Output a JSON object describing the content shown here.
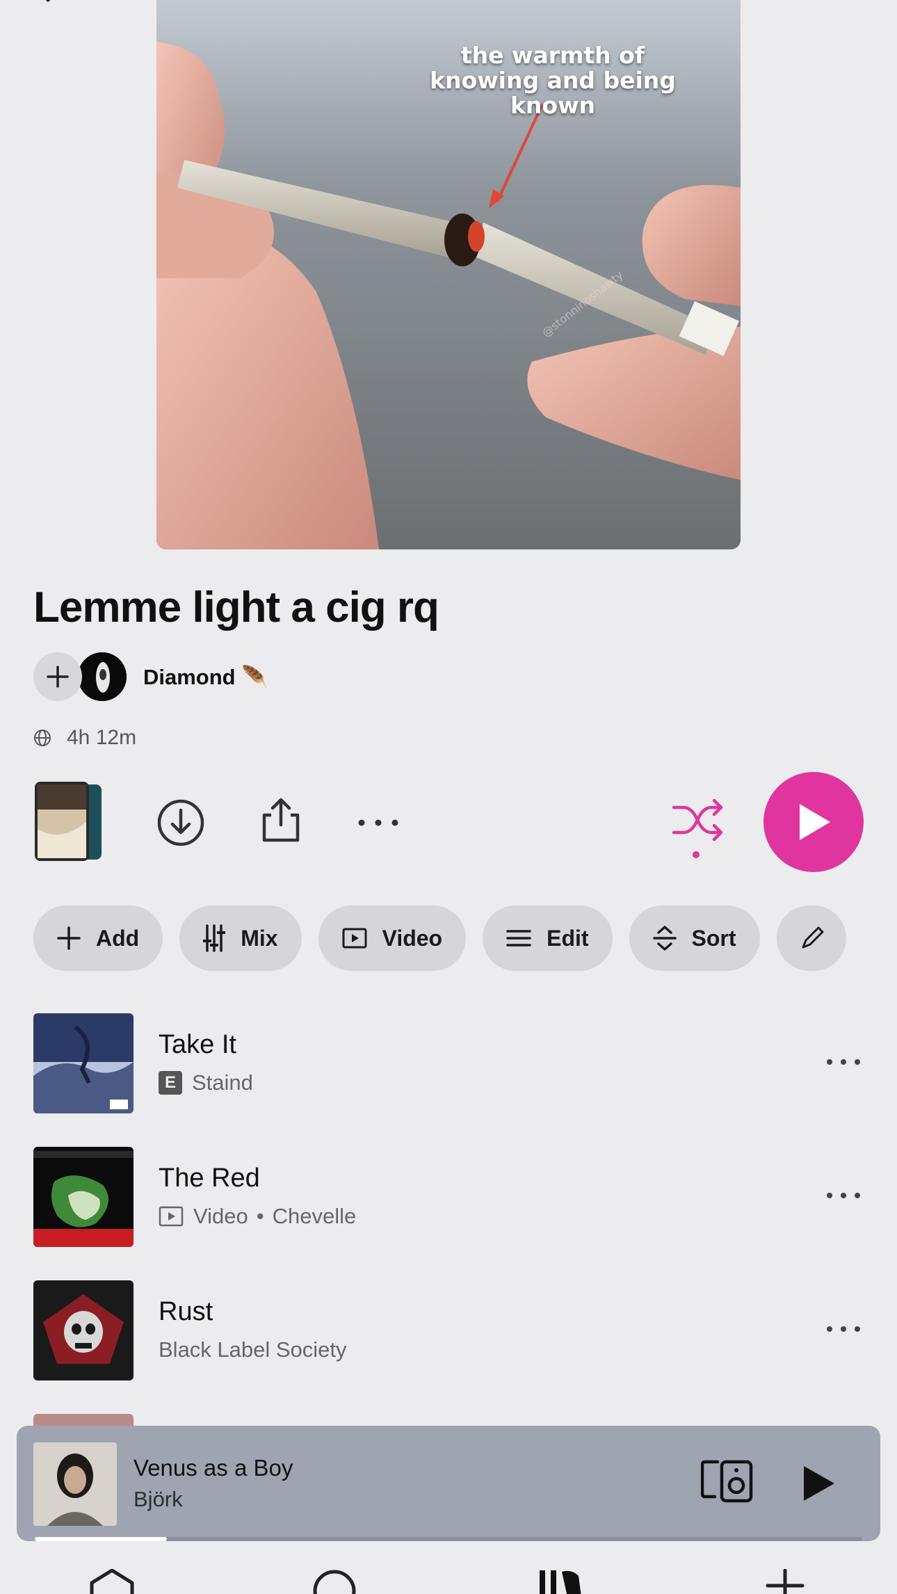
{
  "cover": {
    "caption": "the warmth of knowing and being known",
    "watermark": "@stonninoshawty"
  },
  "playlist": {
    "title": "Lemme light a cig rq",
    "owner": "Diamond 🪶",
    "duration": "4h 12m"
  },
  "colors": {
    "accent": "#e0359e",
    "background": "#ececee",
    "chip": "#d6d6da",
    "mini_player": "#9ea4b2"
  },
  "actions": [
    "download-icon",
    "share-icon",
    "more-icon",
    "shuffle-icon",
    "play-icon"
  ],
  "chips": [
    {
      "label": "Add",
      "icon": "plus-icon"
    },
    {
      "label": "Mix",
      "icon": "sliders-icon"
    },
    {
      "label": "Video",
      "icon": "video-icon"
    },
    {
      "label": "Edit",
      "icon": "list-icon"
    },
    {
      "label": "Sort",
      "icon": "sort-icon"
    },
    {
      "label": "",
      "icon": "pencil-icon"
    }
  ],
  "tracks": [
    {
      "title": "Take It",
      "explicit": "E",
      "artist": "Staind"
    },
    {
      "title": "The Red",
      "video_label": "Video",
      "separator": "•",
      "artist": "Chevelle"
    },
    {
      "title": "Rust",
      "artist": "Black Label Society"
    }
  ],
  "now_playing": {
    "title": "Venus as a Boy",
    "artist": "Björk",
    "progress": 0.16
  },
  "bottom_nav": [
    "home-icon",
    "search-icon",
    "library-icon",
    "add-icon"
  ]
}
